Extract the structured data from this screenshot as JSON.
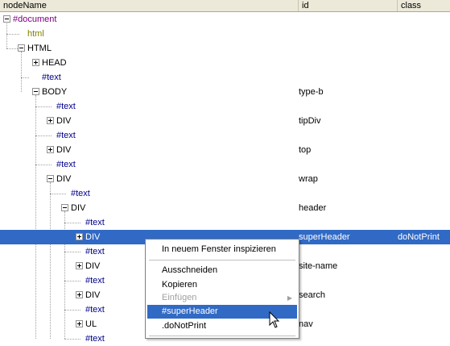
{
  "columns": {
    "node_name": "nodeName",
    "id": "id",
    "class": "class"
  },
  "tree": {
    "document": "#document",
    "html_lc": "html",
    "html": "HTML",
    "head": "HEAD",
    "text_1": "#text",
    "body": "BODY",
    "body_id": "type-b",
    "text_2": "#text",
    "div_tip": "DIV",
    "div_tip_id": "tipDiv",
    "text_3": "#text",
    "div_top": "DIV",
    "div_top_id": "top",
    "text_4": "#text",
    "div_wrap": "DIV",
    "div_wrap_id": "wrap",
    "text_5": "#text",
    "div_header": "DIV",
    "div_header_id": "header",
    "text_6": "#text",
    "div_super": "DIV",
    "div_super_id": "superHeader",
    "div_super_class": "doNotPrint",
    "text_7": "#text",
    "div_site": "DIV",
    "div_site_id": "site-name",
    "text_8": "#text",
    "div_search": "DIV",
    "div_search_id": "search",
    "text_9": "#text",
    "ul": "UL",
    "ul_id": "nav",
    "text_10": "#text"
  },
  "context_menu": {
    "inspect_new_window": "In neuem Fenster inspizieren",
    "cut": "Ausschneiden",
    "copy": "Kopieren",
    "paste": "Einfügen",
    "copy_id": "#superHeader",
    "copy_class": ".doNotPrint"
  }
}
